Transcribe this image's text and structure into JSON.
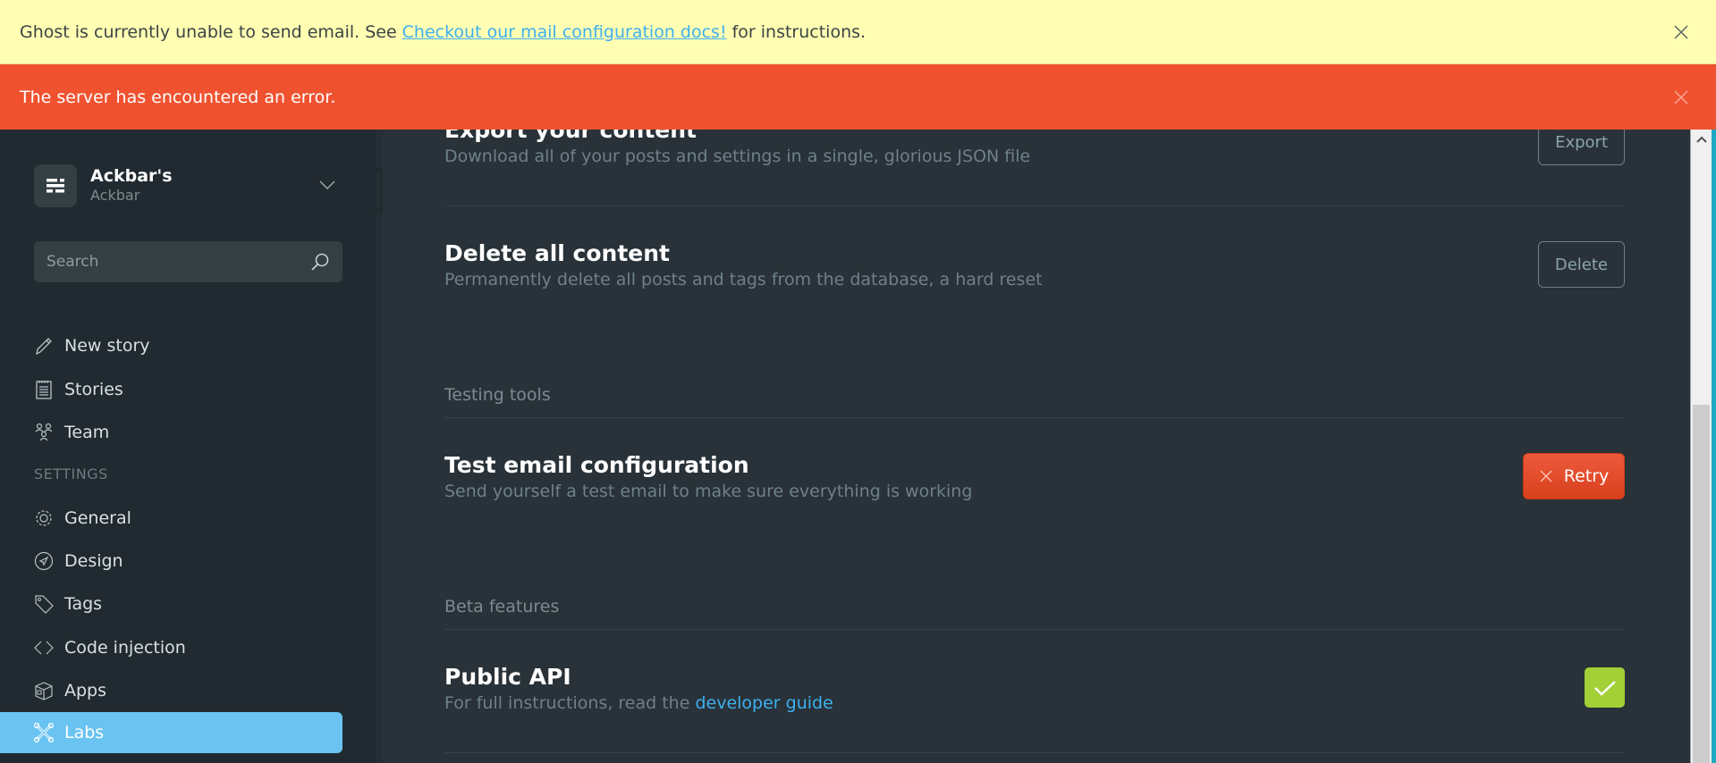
{
  "alerts": {
    "warning": {
      "text_before": "Ghost is currently unable to send email. See",
      "link": "Checkout our mail configuration docs!",
      "text_after": "for instructions."
    },
    "error": {
      "text": "The server has encountered an error."
    }
  },
  "sidebar": {
    "blog_title": "Ackbar's",
    "user_name": "Ackbar",
    "search_placeholder": "Search",
    "nav": [
      {
        "label": "New story",
        "icon": "pen-icon"
      },
      {
        "label": "Stories",
        "icon": "notepad-icon"
      },
      {
        "label": "Team",
        "icon": "team-icon"
      }
    ],
    "settings_heading": "SETTINGS",
    "settings": [
      {
        "label": "General",
        "icon": "gear-icon"
      },
      {
        "label": "Design",
        "icon": "compass-icon"
      },
      {
        "label": "Tags",
        "icon": "tag-icon"
      },
      {
        "label": "Code injection",
        "icon": "code-icon"
      },
      {
        "label": "Apps",
        "icon": "box-icon"
      },
      {
        "label": "Labs",
        "icon": "wrench-icon",
        "active": true
      }
    ]
  },
  "main": {
    "export": {
      "title": "Export your content",
      "desc": "Download all of your posts and settings in a single, glorious JSON file",
      "button": "Export"
    },
    "delete": {
      "title": "Delete all content",
      "desc": "Permanently delete all posts and tags from the database, a hard reset",
      "button": "Delete"
    },
    "testing_tools": {
      "label": "Testing tools",
      "title": "Test email configuration",
      "desc": "Send yourself a test email to make sure everything is working",
      "button": "Retry"
    },
    "beta": {
      "label": "Beta features",
      "title": "Public API",
      "desc_before": "For full instructions, read the",
      "link": "developer guide",
      "checked": true
    }
  },
  "colors": {
    "warning_bg": "#fffeb2",
    "error_bg": "#f05230",
    "accent": "#6ac3f1",
    "link": "#3eb0ef",
    "retry_red": "#e04a26",
    "check_green": "#a2d036"
  }
}
